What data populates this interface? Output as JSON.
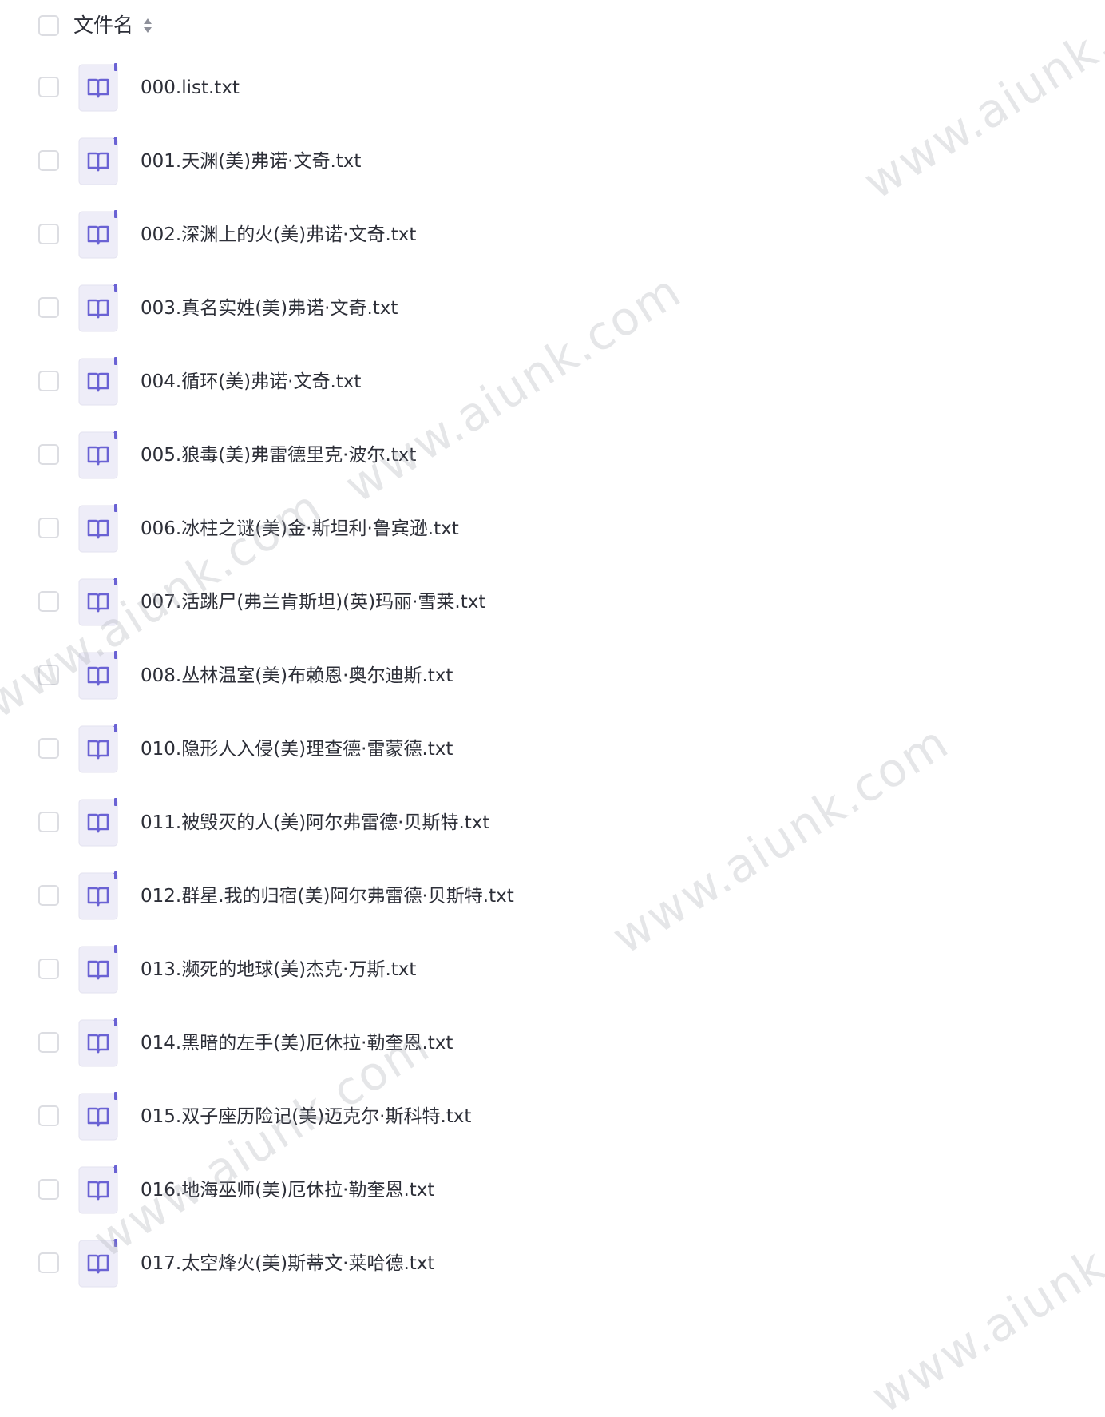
{
  "header": {
    "column_label": "文件名",
    "sort_icon": "sort-up-down-icon"
  },
  "file_icon": "book-file-icon",
  "files": [
    {
      "name": "000.list.txt"
    },
    {
      "name": "001.天渊(美)弗诺·文奇.txt"
    },
    {
      "name": "002.深渊上的火(美)弗诺·文奇.txt"
    },
    {
      "name": "003.真名实姓(美)弗诺·文奇.txt"
    },
    {
      "name": "004.循环(美)弗诺·文奇.txt"
    },
    {
      "name": "005.狼毒(美)弗雷德里克·波尔.txt"
    },
    {
      "name": "006.冰柱之谜(美)金·斯坦利·鲁宾逊.txt"
    },
    {
      "name": "007.活跳尸(弗兰肯斯坦)(英)玛丽·雪莱.txt"
    },
    {
      "name": "008.丛林温室(美)布赖恩·奥尔迪斯.txt"
    },
    {
      "name": "010.隐形人入侵(美)理查德·雷蒙德.txt"
    },
    {
      "name": "011.被毁灭的人(美)阿尔弗雷德·贝斯特.txt"
    },
    {
      "name": "012.群星.我的归宿(美)阿尔弗雷德·贝斯特.txt"
    },
    {
      "name": "013.濒死的地球(美)杰克·万斯.txt"
    },
    {
      "name": "014.黑暗的左手(美)厄休拉·勒奎恩.txt"
    },
    {
      "name": "015.双子座历险记(美)迈克尔·斯科特.txt"
    },
    {
      "name": "016.地海巫师(美)厄休拉·勒奎恩.txt"
    },
    {
      "name": "017.太空烽火(美)斯蒂文·莱哈德.txt"
    }
  ],
  "watermark": {
    "text": "www.aiunk.com"
  },
  "colors": {
    "icon_bg": "#eeedf8",
    "icon_accent": "#6a62d4",
    "checkbox_border": "#dcdde2",
    "text": "#2d2f38"
  }
}
